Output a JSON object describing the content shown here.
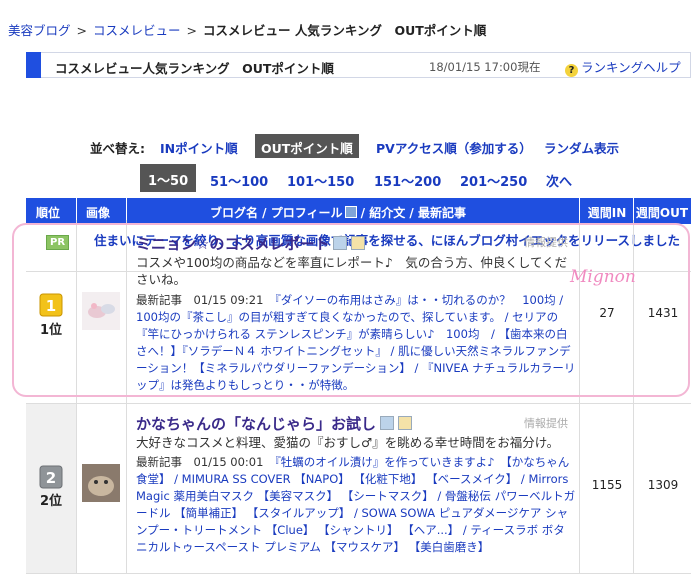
{
  "breadcrumb": {
    "home": "美容ブログ",
    "cat": "コスメレビュー",
    "current": "コスメレビュー 人気ランキング　OUTポイント順"
  },
  "titlebar": {
    "title": "コスメレビュー人気ランキング　OUTポイント順",
    "date": "18/01/15 17:00現在",
    "help": "ランキングヘルプ"
  },
  "sort": {
    "label": "並べ替え:",
    "options": [
      "INポイント順",
      "OUTポイント順",
      "PVアクセス順（参加する）",
      "ランダム表示"
    ]
  },
  "pages": [
    "1～50",
    "51～100",
    "101～150",
    "151～200",
    "201～250",
    "次へ"
  ],
  "table_headers": [
    "順位",
    "画像",
    "ブログ名 / プロフィール",
    "紹介文 / 最新記事",
    "週間IN",
    "週間OUT"
  ],
  "pr": {
    "badge": "PR",
    "text": "住まいにテーマを絞り、より高画質な画像で記事を探せる、にほんブログ村イエックをリリースしました"
  },
  "rows": [
    {
      "rank": "1位",
      "rank_num": "1",
      "name": "ミニョン☆のコスメレポート",
      "provider": "情報提供",
      "desc": "コスメや100均の商品などを率直にレポート♪　気の合う方、仲良くしてくださいね。",
      "recent_label": "最新記事",
      "recent_time": "01/15 09:21",
      "recent": "『ダイソーの布用はさみ』は・・切れるのか？　100均 / 100均の『茶こし』の目が粗すぎて良くなかったので、探しています。 / セリアの『竿にひっかけられる ステンレスピンチ』が素晴らしい♪　100均　/ 【歯本来の白さへ！】『ソラデーＮ４ ホワイトニングセット』 / 肌に優しい天然ミネラルファンデーション！【ミネラルパウダリーファンデーション】 / 『NIVEA ナチュラルカラーリップ』は発色よりもしっとり・・が特徴。",
      "in": "27",
      "out": "1431"
    },
    {
      "rank": "2位",
      "rank_num": "2",
      "name": "かなちゃんの「なんじゃら」お試し",
      "provider": "情報提供",
      "desc": "大好きなコスメと料理、愛猫の『おすし♂』を眺める幸せ時間をお福分け。",
      "recent_label": "最新記事",
      "recent_time": "01/15 00:01",
      "recent": "『牡蠣のオイル漬け』を作っていきますよ♪　【かなちゃん食堂】 / MIMURA SS COVER 【NAPO】 【化粧下地】 【ベースメイク】 / Mirrors Magic 薬用美白マスク 【美容マスク】 【シートマスク】 / 骨盤秘伝 パワーベルトガードル 【簡単補正】 【スタイルアップ】 / SOWA SOWA ピュアダメージケア シャンプー・トリートメント 【Clue】 【シャントリ】 【ヘア...】 / ティースラボ ボタニカルトゥースペースト プレミアム 【マウスケア】 【美白歯磨き】",
      "in": "1155",
      "out": "1309"
    }
  ],
  "annotation": "Mignon",
  "colors": {
    "accent": "#1f4fe0",
    "link": "#1a3bbf",
    "highlight": "#f3b6d4"
  }
}
